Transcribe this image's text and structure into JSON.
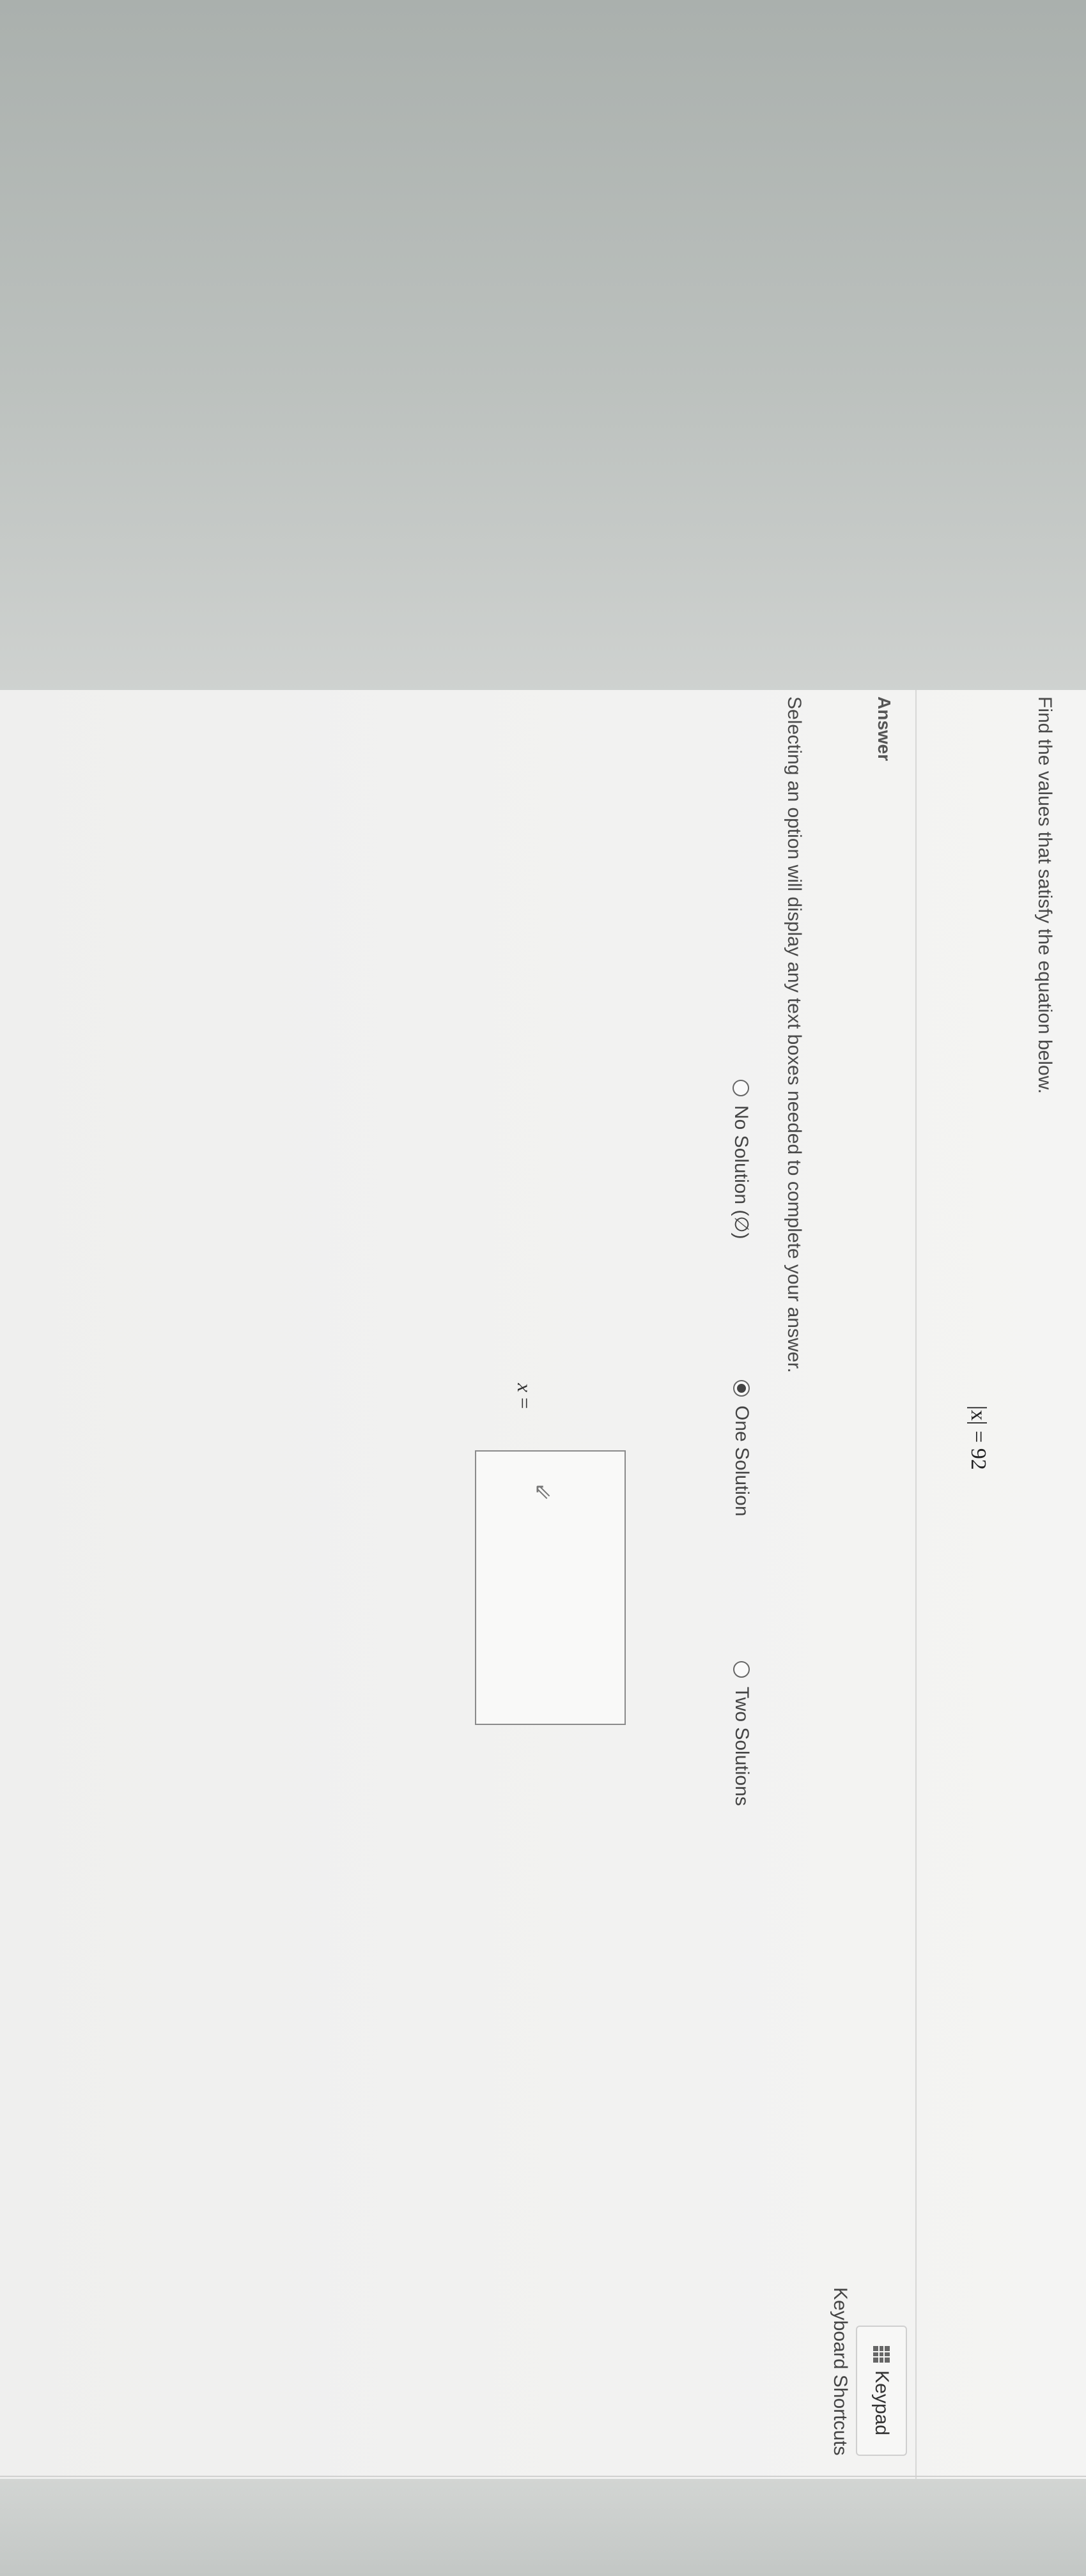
{
  "question": {
    "prompt": "Find the values that satisfy the equation below.",
    "equation": "|x| = 92"
  },
  "answer": {
    "label": "Answer",
    "instruction": "Selecting an option will display any text boxes needed to complete your answer.",
    "options": [
      {
        "label": "No Solution (∅)",
        "selected": false
      },
      {
        "label": "One Solution",
        "selected": true
      },
      {
        "label": "Two Solutions",
        "selected": false
      }
    ],
    "variable": "x",
    "equals": "=",
    "input_value": ""
  },
  "toolbar": {
    "keypad_label": "Keypad",
    "shortcuts_label": "Keyboard Shortcuts"
  },
  "icons": {
    "keypad": "keypad-grid-icon",
    "cursor": "mouse-pointer-icon"
  }
}
